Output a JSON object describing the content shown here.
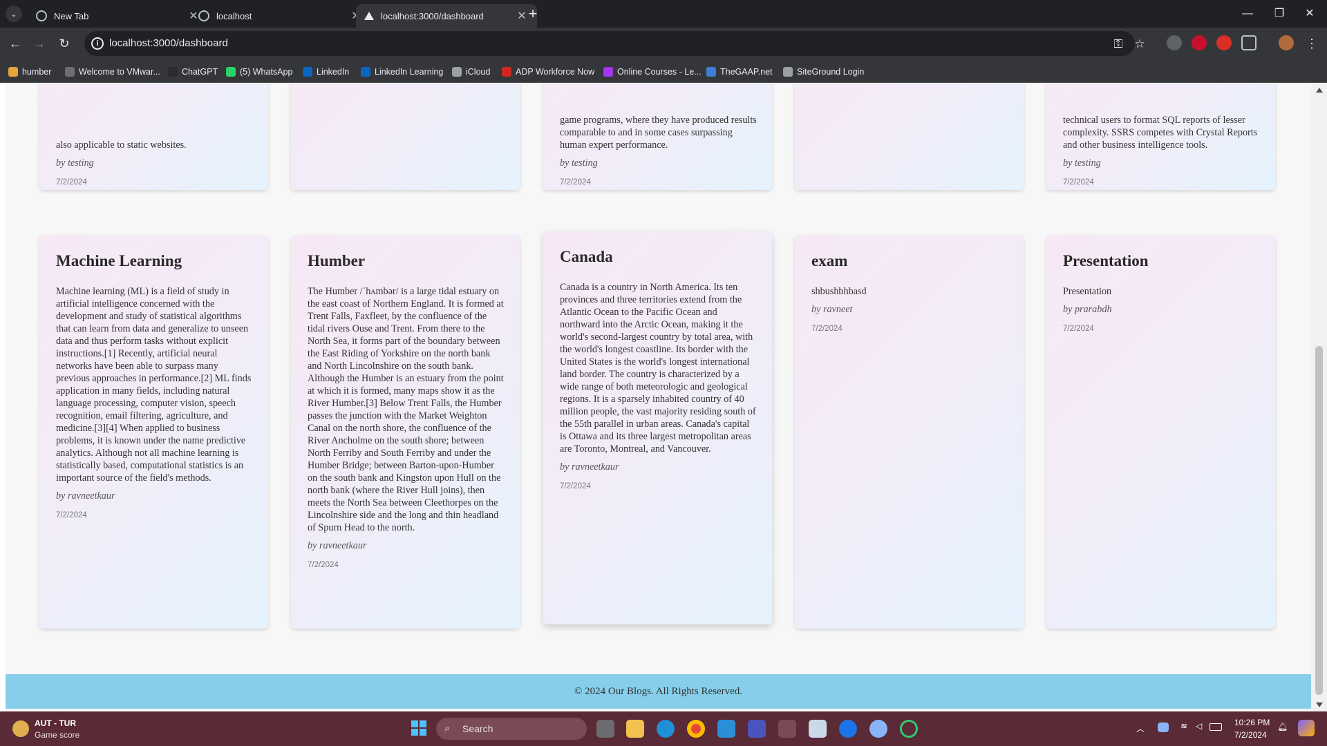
{
  "browser": {
    "tabs": [
      {
        "label": "New Tab",
        "close": "✕"
      },
      {
        "label": "localhost",
        "close": "✕"
      },
      {
        "label": "localhost:3000/dashboard",
        "close": "✕"
      }
    ],
    "new_tab": "+",
    "tab_menu": "⌄",
    "window_controls": {
      "minimize": "—",
      "restore": "❐",
      "close": "✕"
    },
    "nav": {
      "back": "←",
      "forward": "→",
      "reload": "↻"
    },
    "url": "localhost:3000/dashboard",
    "info_icon": "i",
    "omnibox_icons": {
      "key": "⚿",
      "star": "☆"
    },
    "menu": "⋮",
    "bookmarks": [
      {
        "label": "humber",
        "color": "#e8a33d"
      },
      {
        "label": "Welcome to VMwar...",
        "color": "#6d6e71"
      },
      {
        "label": "ChatGPT",
        "color": "#2b2b2b"
      },
      {
        "label": "(5) WhatsApp",
        "color": "#25d366"
      },
      {
        "label": "LinkedIn",
        "color": "#0a66c2"
      },
      {
        "label": "LinkedIn Learning",
        "color": "#0a66c2"
      },
      {
        "label": "iCloud",
        "color": "#9aa0a6"
      },
      {
        "label": "ADP Workforce Now",
        "color": "#d0271d"
      },
      {
        "label": "Online Courses - Le...",
        "color": "#a435f0"
      },
      {
        "label": "TheGAAP.net",
        "color": "#3d7fd6"
      },
      {
        "label": "SiteGround Login",
        "color": "#9aa0a6"
      }
    ]
  },
  "top_cards": [
    {
      "body": "also applicable to static websites.",
      "author": "by testing",
      "date": "7/2/2024"
    },
    {
      "body": "",
      "author": "",
      "date": ""
    },
    {
      "body": "game programs, where they have produced results comparable to and in some cases surpassing human expert performance.",
      "author": "by testing",
      "date": "7/2/2024"
    },
    {
      "body": "",
      "author": "",
      "date": ""
    },
    {
      "body": "technical users to format SQL reports of lesser complexity. SSRS competes with Crystal Reports and other business intelligence tools.",
      "author": "by testing",
      "date": "7/2/2024"
    }
  ],
  "cards": [
    {
      "title": "Machine Learning",
      "body": "Machine learning (ML) is a field of study in artificial intelligence concerned with the development and study of statistical algorithms that can learn from data and generalize to unseen data and thus perform tasks without explicit instructions.[1] Recently, artificial neural networks have been able to surpass many previous approaches in performance.[2] ML finds application in many fields, including natural language processing, computer vision, speech recognition, email filtering, agriculture, and medicine.[3][4] When applied to business problems, it is known under the name predictive analytics. Although not all machine learning is statistically based, computational statistics is an important source of the field's methods.",
      "author": "by ravneetkaur",
      "date": "7/2/2024"
    },
    {
      "title": "Humber",
      "body": "The Humber /ˈhʌmbər/ is a large tidal estuary on the east coast of Northern England. It is formed at Trent Falls, Faxfleet, by the confluence of the tidal rivers Ouse and Trent. From there to the North Sea, it forms part of the boundary between the East Riding of Yorkshire on the north bank and North Lincolnshire on the south bank. Although the Humber is an estuary from the point at which it is formed, many maps show it as the River Humber.[3] Below Trent Falls, the Humber passes the junction with the Market Weighton Canal on the north shore, the confluence of the River Ancholme on the south shore; between North Ferriby and South Ferriby and under the Humber Bridge; between Barton-upon-Humber on the south bank and Kingston upon Hull on the north bank (where the River Hull joins), then meets the North Sea between Cleethorpes on the Lincolnshire side and the long and thin headland of Spurn Head to the north.",
      "author": "by ravneetkaur",
      "date": "7/2/2024"
    },
    {
      "title": "Canada",
      "body": "Canada is a country in North America. Its ten provinces and three territories extend from the Atlantic Ocean to the Pacific Ocean and northward into the Arctic Ocean, making it the world's second-largest country by total area, with the world's longest coastline. Its border with the United States is the world's longest international land border. The country is characterized by a wide range of both meteorologic and geological regions. It is a sparsely inhabited country of 40 million people, the vast majority residing south of the 55th parallel in urban areas. Canada's capital is Ottawa and its three largest metropolitan areas are Toronto, Montreal, and Vancouver.",
      "author": "by ravneetkaur",
      "date": "7/2/2024"
    },
    {
      "title": "exam",
      "body": "shbushbhbasd",
      "author": "by ravneet",
      "date": "7/2/2024"
    },
    {
      "title": "Presentation",
      "body": "Presentation",
      "author": "by prarabdh",
      "date": "7/2/2024"
    }
  ],
  "footer": "© 2024 Our Blogs. All Rights Reserved.",
  "taskbar": {
    "widget_title": "AUT - TUR",
    "widget_subtitle": "Game score",
    "search_placeholder": "Search",
    "time": "10:26 PM",
    "date": "7/2/2024"
  }
}
